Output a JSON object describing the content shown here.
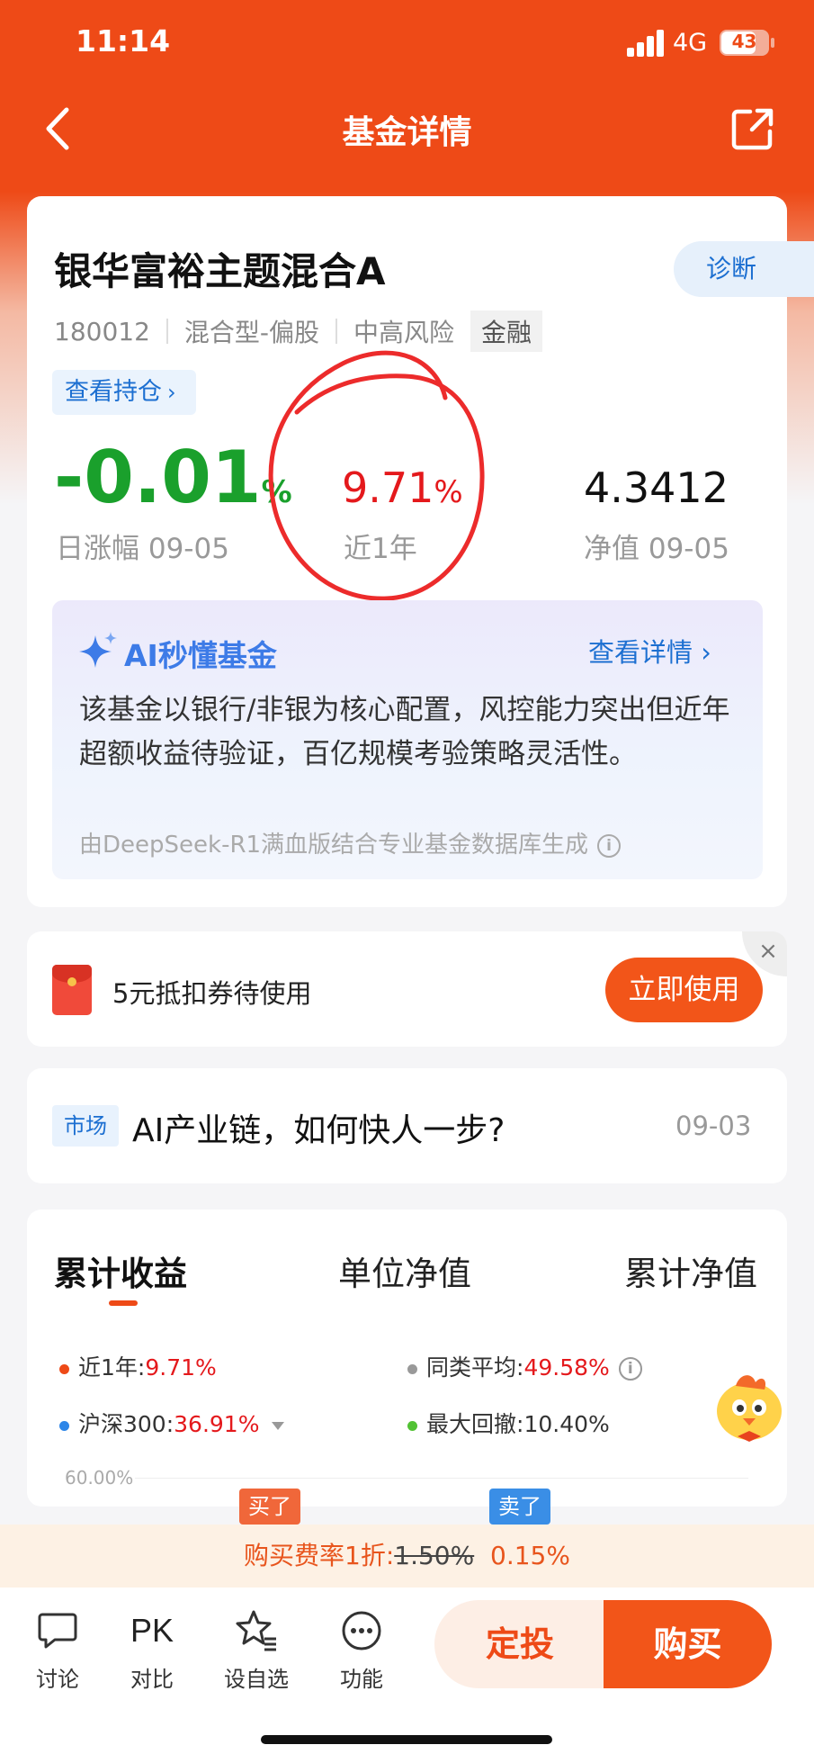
{
  "status_bar": {
    "time": "11:14",
    "network": "4G",
    "battery": "43"
  },
  "nav": {
    "title": "基金详情",
    "back_icon": "chevron-left-icon",
    "share_icon": "share-icon"
  },
  "fund": {
    "name": "银华富裕主题混合A",
    "diagnose_label": "诊断",
    "code": "180012",
    "type": "混合型-偏股",
    "risk": "中高风险",
    "sector_tag": "金融",
    "holdings_link": "查看持仓",
    "day_change": "-0.01",
    "day_change_unit": "%",
    "day_change_label": "日涨幅 09-05",
    "year_return": "9.71",
    "year_return_unit": "%",
    "year_return_label": "近1年",
    "nav_value": "4.3412",
    "nav_label": "净值 09-05"
  },
  "ai_summary": {
    "title": "AI秒懂基金",
    "more_label": "查看详情",
    "text": "该基金以银行/非银为核心配置，风控能力突出但近年超额收益待验证，百亿规模考验策略灵活性。",
    "source": "由DeepSeek-R1满血版结合专业基金数据库生成"
  },
  "coupon": {
    "text": "5元抵扣券待使用",
    "button": "立即使用",
    "close": "×"
  },
  "news": {
    "tag": "市场",
    "title": "AI产业链，如何快人一步?",
    "date": "09-03"
  },
  "chart_tabs": [
    "累计收益",
    "单位净值",
    "累计净值"
  ],
  "legend": {
    "year_label": "近1年:",
    "year_value": "9.71%",
    "peer_label": "同类平均:",
    "peer_value": "49.58%",
    "hs300_label": "沪深300:",
    "hs300_value": "36.91%",
    "drawdown_label": "最大回撤:",
    "drawdown_value": "10.40%"
  },
  "chart": {
    "y_top": "60.00%",
    "buy_flag": "买了",
    "sell_flag": "卖了"
  },
  "colors": {
    "brand": "#ee4a17",
    "up": "#e4191c",
    "down": "#1aa02c",
    "link": "#1c6fd1"
  },
  "fee": {
    "label": "购买费率1折:",
    "original": "1.50%",
    "discount": "0.15%"
  },
  "tabbar": {
    "discuss": "讨论",
    "pk_text": "PK",
    "pk": "对比",
    "watch": "设自选",
    "func": "功能",
    "dingtou": "定投",
    "buy": "购买"
  }
}
